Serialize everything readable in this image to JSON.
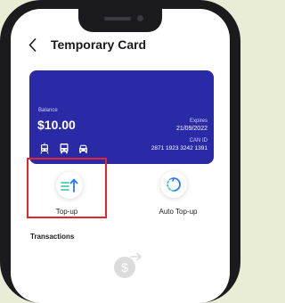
{
  "header": {
    "back_icon": "chevron-left-icon",
    "title": "Temporary Card"
  },
  "card": {
    "color": "#2b2aa6",
    "balance_label": "Balance",
    "balance_value": "$10.00",
    "expires_label": "Expires",
    "expires_value": "21/09/2022",
    "can_label": "CAN ID",
    "can_value": "2871 1923 3242 1391",
    "mode_icons": [
      "tram-icon",
      "bus-icon",
      "car-icon"
    ]
  },
  "actions": [
    {
      "label": "Top-up",
      "icon": "top-up-icon",
      "highlight_color": "#e0262a"
    },
    {
      "label": "Auto Top-up",
      "icon": "auto-top-up-icon"
    }
  ],
  "transactions": {
    "title": "Transactions",
    "empty_icon": "money-transfer-icon"
  },
  "colors": {
    "accent_green": "#4cc9a8",
    "accent_blue": "#2979ff",
    "background": "#e9edd6"
  }
}
